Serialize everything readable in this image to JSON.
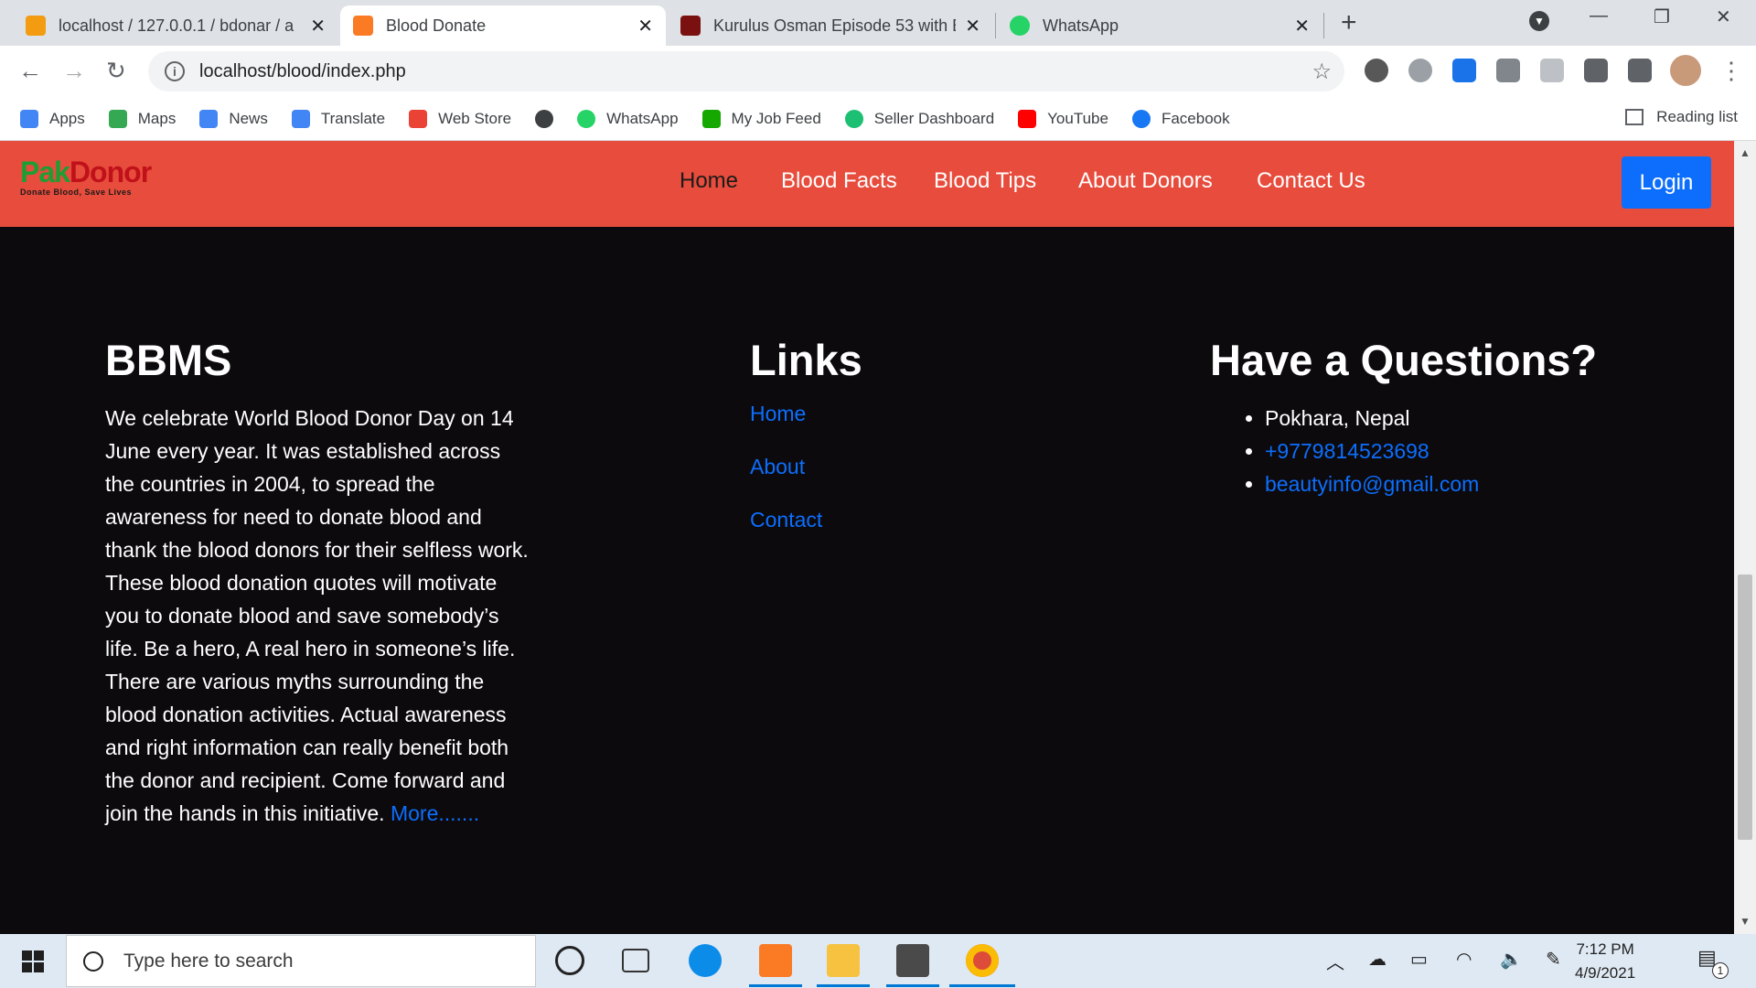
{
  "browser": {
    "tabs": [
      {
        "title": "localhost / 127.0.0.1 / bdonar / a",
        "icon": "phpmyadmin-icon",
        "active": false
      },
      {
        "title": "Blood Donate",
        "icon": "xampp-icon",
        "active": true
      },
      {
        "title": "Kurulus Osman Episode 53 with E",
        "icon": "video-site-icon",
        "active": false
      },
      {
        "title": "WhatsApp",
        "icon": "whatsapp-icon",
        "active": false
      }
    ],
    "url": "localhost/blood/index.php",
    "bookmarks": [
      "Apps",
      "Maps",
      "News",
      "Translate",
      "Web Store",
      "",
      "WhatsApp",
      "My Job Feed",
      "Seller Dashboard",
      "YouTube",
      "Facebook"
    ],
    "reading_list": "Reading list"
  },
  "site": {
    "logo_pak": "Pak",
    "logo_donor": "Donor",
    "logo_tagline": "Donate Blood, Save Lives",
    "nav": [
      "Home",
      "Blood Facts",
      "Blood Tips",
      "About Donors",
      "Contact Us"
    ],
    "login": "Login"
  },
  "footer": {
    "about_title": "BBMS",
    "about_text": "We celebrate World Blood Donor Day on 14 June every year. It was established across the countries in 2004, to spread the awareness for need to donate blood and thank the blood donors for their selfless work. These blood donation quotes will motivate you to donate blood and save somebody’s life. Be a hero, A real hero in someone’s life. There are various myths surrounding the blood donation activities. Actual awareness and right information can really benefit both the donor and recipient. Come forward and join the hands in this initiative.",
    "more_link": "More.......",
    "links_title": "Links",
    "links": [
      "Home",
      "About",
      "Contact"
    ],
    "contact_title": "Have a Questions?",
    "address": "Pokhara, Nepal",
    "phone": "+9779814523698",
    "email": "beautyinfo@gmail.com"
  },
  "taskbar": {
    "search_placeholder": "Type here to search",
    "time": "7:12 PM",
    "date": "4/9/2021",
    "notifications": "1"
  },
  "colors": {
    "navbar": "#e74c3c",
    "footer_bg": "#0c0a0d",
    "link": "#0d6efd"
  }
}
